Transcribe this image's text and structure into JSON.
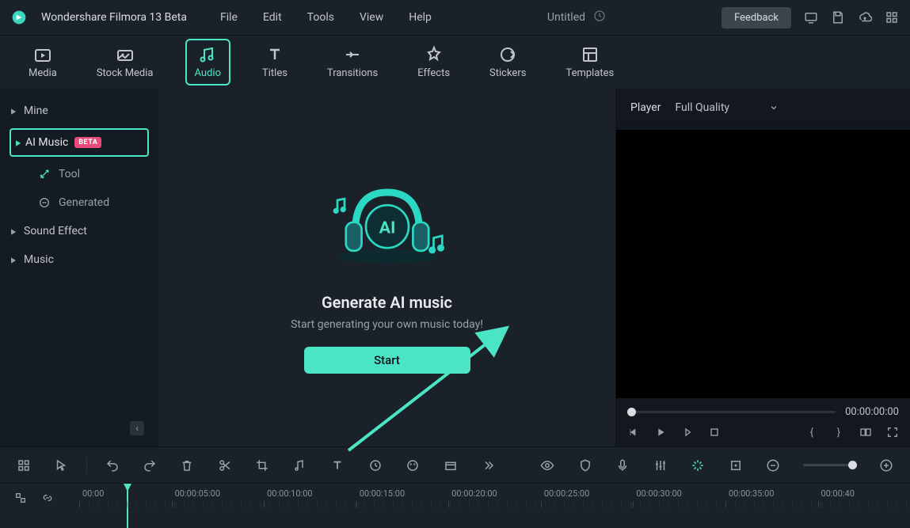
{
  "app": {
    "title": "Wondershare Filmora 13 Beta",
    "document": "Untitled",
    "feedback_label": "Feedback"
  },
  "menubar": [
    "File",
    "Edit",
    "Tools",
    "View",
    "Help"
  ],
  "topnav": [
    {
      "label": "Media",
      "icon": "media",
      "active": false
    },
    {
      "label": "Stock Media",
      "icon": "stock",
      "active": false
    },
    {
      "label": "Audio",
      "icon": "audio",
      "active": true
    },
    {
      "label": "Titles",
      "icon": "titles",
      "active": false
    },
    {
      "label": "Transitions",
      "icon": "transitions",
      "active": false
    },
    {
      "label": "Effects",
      "icon": "effects",
      "active": false
    },
    {
      "label": "Stickers",
      "icon": "stickers",
      "active": false
    },
    {
      "label": "Templates",
      "icon": "templates",
      "active": false
    }
  ],
  "sidebar": {
    "items": [
      {
        "label": "Mine",
        "type": "group"
      },
      {
        "label": "AI Music",
        "type": "group",
        "badge": "BETA",
        "active": true
      },
      {
        "label": "Tool",
        "type": "sub",
        "icon": "wand"
      },
      {
        "label": "Generated",
        "type": "sub",
        "icon": "list"
      },
      {
        "label": "Sound Effect",
        "type": "group"
      },
      {
        "label": "Music",
        "type": "group"
      }
    ]
  },
  "center": {
    "title": "Generate AI music",
    "subtitle": "Start generating your own music today!",
    "start_label": "Start"
  },
  "player": {
    "label": "Player",
    "quality": "Full Quality",
    "timecode": "00:00:00:00"
  },
  "timeline": {
    "marks": [
      "00:00",
      "00:00:05:00",
      "00:00:10:00",
      "00:00:15:00",
      "00:00:20:00",
      "00:00:25:00",
      "00:00:30:00",
      "00:00:35:00",
      "00:00:40"
    ]
  }
}
